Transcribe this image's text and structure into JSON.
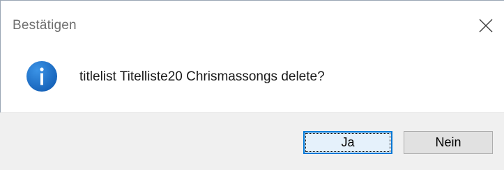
{
  "dialog": {
    "title": "Bestätigen",
    "close_icon": "close-icon",
    "message_icon": "info-icon",
    "message": "titlelist Titelliste20 Chrismassongs delete?",
    "buttons": {
      "yes_label": "Ja",
      "no_label": "Nein"
    },
    "colors": {
      "accent": "#0078d7",
      "info_icon_fill": "#1c6fc7",
      "footer_bg": "#f0f0f0",
      "title_text": "#6f6f6f"
    }
  }
}
